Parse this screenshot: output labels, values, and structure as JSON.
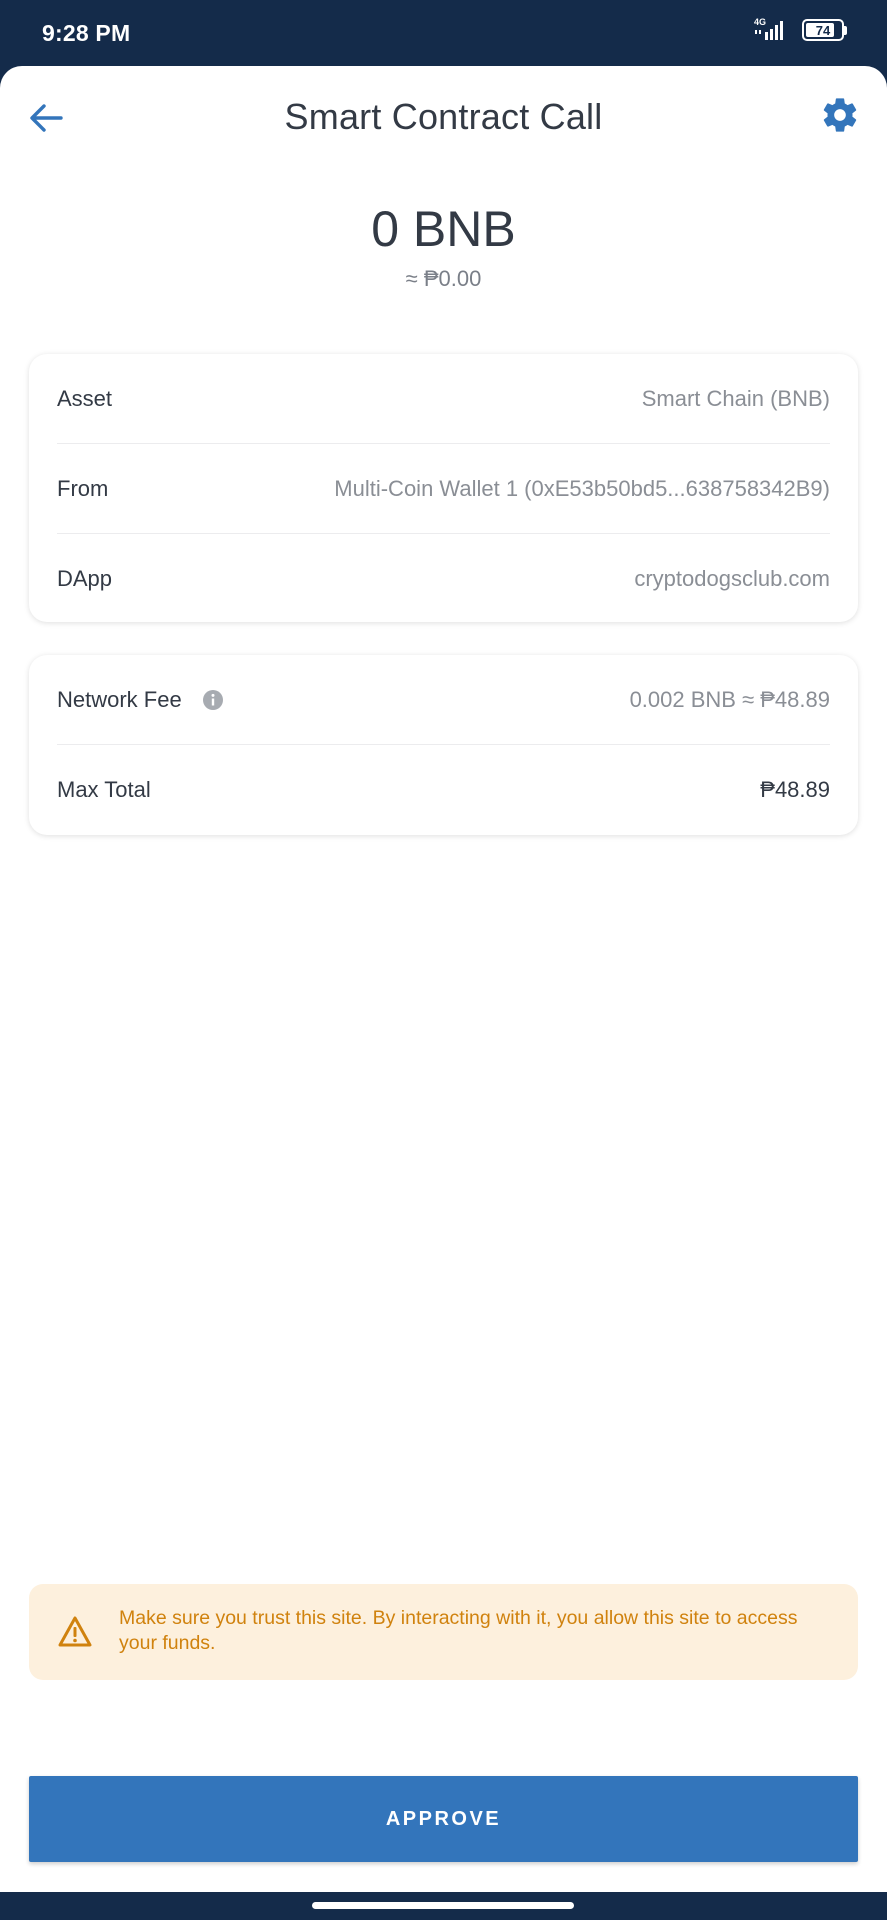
{
  "status_bar": {
    "time": "9:28 PM",
    "network": "4G",
    "battery": "74"
  },
  "header": {
    "title": "Smart Contract Call"
  },
  "amount": {
    "value": "0 BNB",
    "fiat": "≈ ₱0.00"
  },
  "details": {
    "asset_label": "Asset",
    "asset_value": "Smart Chain (BNB)",
    "from_label": "From",
    "from_value": "Multi-Coin Wallet 1 (0xE53b50bd5...638758342B9)",
    "dapp_label": "DApp",
    "dapp_value": "cryptodogsclub.com"
  },
  "fees": {
    "network_fee_label": "Network Fee",
    "network_fee_value": "0.002 BNB ≈ ₱48.89",
    "max_total_label": "Max Total",
    "max_total_value": "₱48.89"
  },
  "warning": {
    "text": "Make sure you trust this site. By interacting with it, you allow this site to access your funds."
  },
  "actions": {
    "approve_label": "APPROVE"
  },
  "colors": {
    "primary": "#3375bb",
    "status_bar": "#142b4a",
    "warning_bg": "#fdf0dd",
    "warning_text": "#d0820e"
  }
}
